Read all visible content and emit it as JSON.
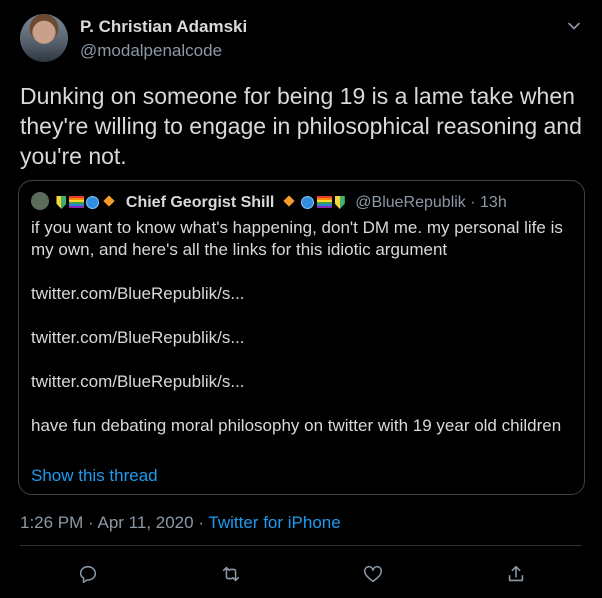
{
  "author": {
    "name": "P. Christian Adamski",
    "handle": "@modalpenalcode"
  },
  "tweet": {
    "text": "Dunking on someone for being 19 is a lame take when they're willing to engage in philosophical reasoning and you're not."
  },
  "quote": {
    "name": "Chief Georgist Shill",
    "handle": "@BlueRepublik",
    "time": "13h",
    "paragraphs": [
      "if you want to know what's happening, don't DM me. my personal life is my own, and here's all the links for this idiotic argument",
      "twitter.com/BlueRepublik/s...",
      "twitter.com/BlueRepublik/s...",
      "twitter.com/BlueRepublik/s...",
      "have fun debating moral philosophy on twitter with 19 year old children"
    ],
    "show_thread": "Show this thread"
  },
  "meta": {
    "time": "1:26 PM",
    "date": "Apr 11, 2020",
    "source": "Twitter for iPhone"
  },
  "icons": [
    "chevron-down-icon",
    "reply-icon",
    "retweet-icon",
    "like-icon",
    "share-icon"
  ],
  "colors": {
    "background": "#000000",
    "accent": "#1d9bf0",
    "muted": "#8b98a5",
    "border": "#38444d"
  }
}
